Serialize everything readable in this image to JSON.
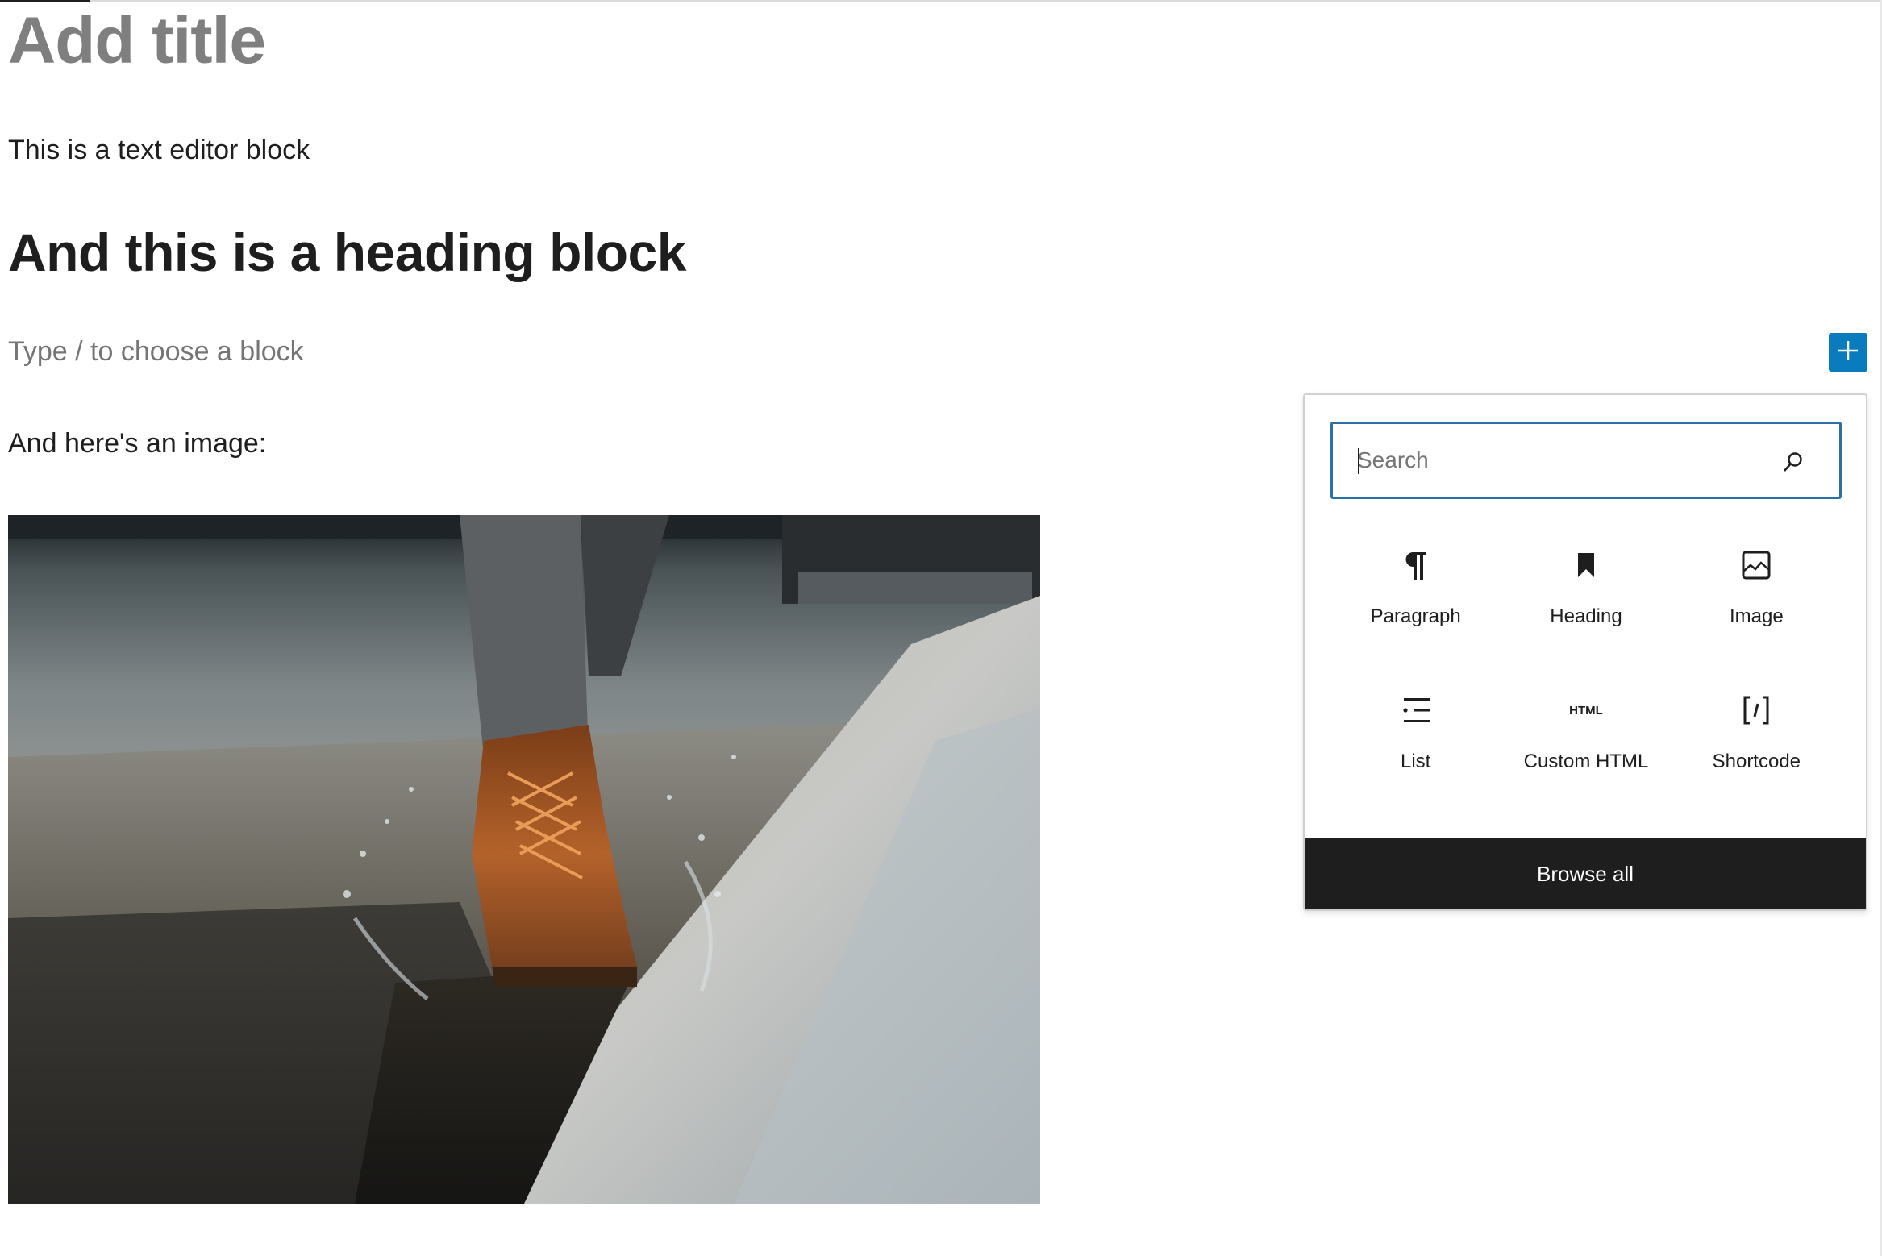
{
  "editor": {
    "title_placeholder": "Add title",
    "blocks": {
      "paragraph_1": "This is a text editor block",
      "heading": "And this is a heading block",
      "empty_placeholder": "Type / to choose a block",
      "paragraph_2": "And here's an image:"
    },
    "image": {
      "description": "Brown leather boot splashing in a puddle next to a curb"
    },
    "progress": {
      "value": 0.048
    }
  },
  "inserter": {
    "toggle_icon": "plus-icon",
    "accent_color": "#0a7cbd",
    "search": {
      "placeholder": "Search",
      "value": "",
      "icon": "search-icon"
    },
    "blocks": [
      {
        "label": "Paragraph",
        "icon": "paragraph-icon"
      },
      {
        "label": "Heading",
        "icon": "bookmark-icon"
      },
      {
        "label": "Image",
        "icon": "image-icon"
      },
      {
        "label": "List",
        "icon": "list-icon"
      },
      {
        "label": "Custom HTML",
        "icon": "html-icon",
        "icon_text": "HTML"
      },
      {
        "label": "Shortcode",
        "icon": "shortcode-icon",
        "icon_text": "[/]"
      }
    ],
    "browse_all_label": "Browse all"
  }
}
